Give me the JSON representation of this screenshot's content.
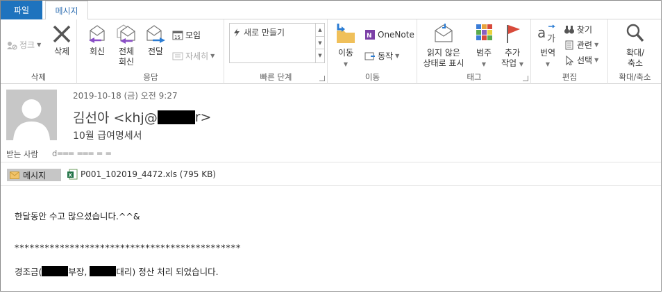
{
  "tabs": {
    "file": "파일",
    "message": "메시지"
  },
  "ribbon": {
    "delete_group": {
      "label": "삭제",
      "junk": "정크",
      "delete": "삭제"
    },
    "respond_group": {
      "label": "응답",
      "reply": "회신",
      "reply_all_1": "전체",
      "reply_all_2": "회신",
      "forward": "전달",
      "meeting": "모임",
      "more": "자세히"
    },
    "quick_group": {
      "label": "빠른 단계",
      "item": "새로 만들기"
    },
    "move_group": {
      "label": "이동",
      "move": "이동",
      "onenote": "OneNote",
      "actions": "동작"
    },
    "tags_group": {
      "label": "태그",
      "unread_1": "읽지 않은",
      "unread_2": "상태로 표시",
      "categorize": "범주",
      "followup_1": "추가",
      "followup_2": "작업"
    },
    "edit_group": {
      "label": "편집",
      "translate": "번역",
      "find": "찾기",
      "related": "관련",
      "select": "선택"
    },
    "zoom_group": {
      "label": "확대/축소",
      "zoom_1": "확대/",
      "zoom_2": "축소"
    }
  },
  "message": {
    "date": "2019-10-18 (금) 오전 9:27",
    "sender_prefix": "김선아  <khj@",
    "sender_suffix": "r>",
    "subject": "10월 급여명세서",
    "to_label": "받는 사람",
    "to_value": "d═══ ═══ ═ ═"
  },
  "attachments": {
    "message_tab": "메시지",
    "file_name": "P001_102019_4472.xls (795 KB)"
  },
  "body": {
    "line1": "한달동안 수고 많으셨습니다.^^&",
    "line2": "*********************************************",
    "line3_a": "경조금(",
    "line3_b": "부장, ",
    "line3_c": "대리) 정산 처리 되었습니다."
  }
}
